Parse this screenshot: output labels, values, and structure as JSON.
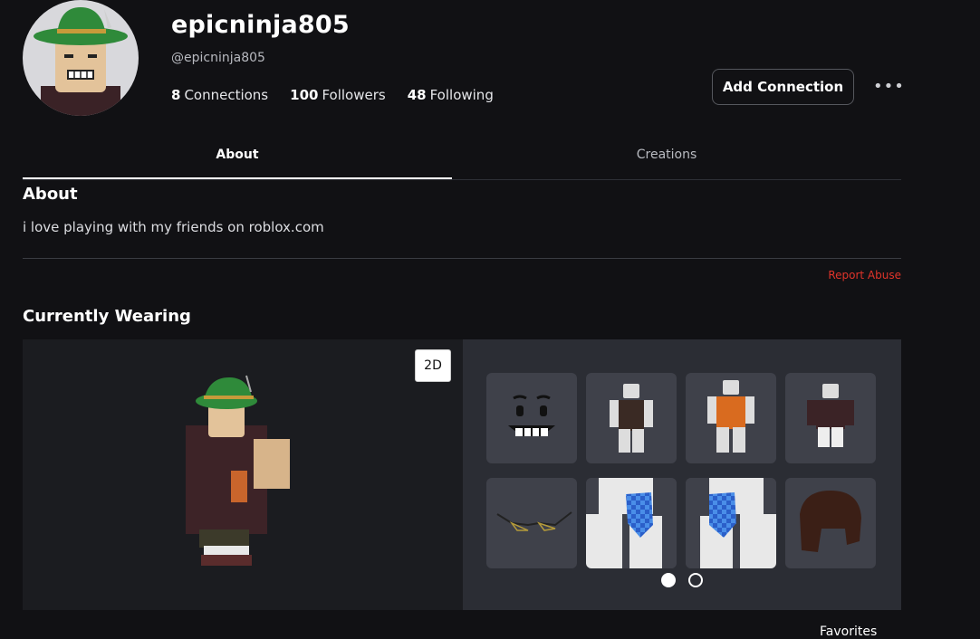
{
  "profile": {
    "username": "epicninja805",
    "handle": "@epicninja805",
    "connections_count": "8",
    "connections_label": "Connections",
    "followers_count": "100",
    "followers_label": "Followers",
    "following_count": "48",
    "following_label": "Following"
  },
  "actions": {
    "add_connection_label": "Add Connection",
    "more_label": "•••"
  },
  "tabs": [
    {
      "label": "About",
      "active": true
    },
    {
      "label": "Creations",
      "active": false
    }
  ],
  "about": {
    "heading": "About",
    "text": "i love playing with my friends on roblox.com",
    "report_label": "Report Abuse"
  },
  "wearing": {
    "heading": "Currently Wearing",
    "view_toggle_label": "2D",
    "items": [
      {
        "icon": "face-icon"
      },
      {
        "icon": "shirt-icon"
      },
      {
        "icon": "orange-shirt-icon"
      },
      {
        "icon": "jacket-icon"
      },
      {
        "icon": "glasses-icon"
      },
      {
        "icon": "checkered-arm-left-icon"
      },
      {
        "icon": "checkered-arm-right-icon"
      },
      {
        "icon": "hair-icon"
      }
    ],
    "pagination": {
      "current": 1,
      "total": 2
    }
  },
  "footer": {
    "favorites_label": "Favorites"
  },
  "colors": {
    "background": "#111114",
    "panel": "#2b2d34",
    "viewer": "#1b1c20",
    "report": "#e0342a",
    "hat": "#2f8a3a"
  }
}
